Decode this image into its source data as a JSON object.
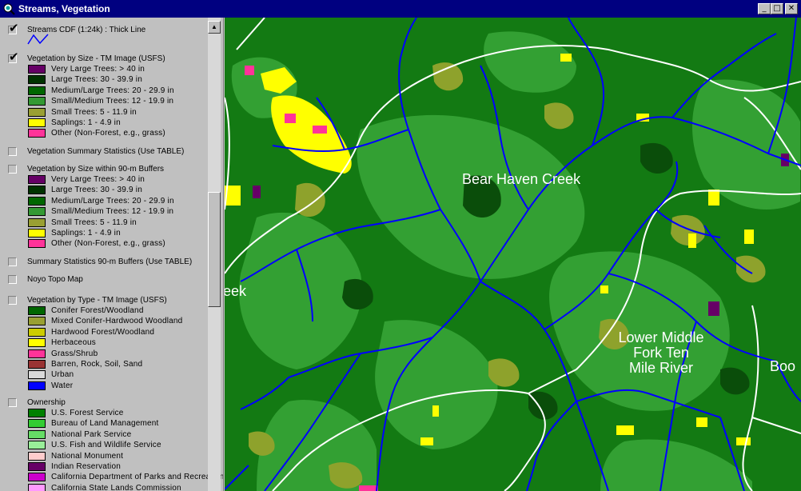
{
  "window": {
    "title": "Streams, Vegetation",
    "minimize_glyph": "_",
    "maximize_glyph": "□",
    "close_glyph": "✕"
  },
  "legend": {
    "streams": {
      "label": "Streams CDF (1:24k) : Thick Line",
      "checked": true
    },
    "veg_size": {
      "label": "Vegetation by Size - TM Image (USFS)",
      "checked": true,
      "classes": [
        {
          "label": "Very Large Trees: > 40  in",
          "color": "#660066"
        },
        {
          "label": "Large Trees: 30 - 39.9 in",
          "color": "#003300"
        },
        {
          "label": "Medium/Large Trees: 20 - 29.9 in",
          "color": "#006600"
        },
        {
          "label": "Small/Medium Trees: 12 - 19.9 in",
          "color": "#339933"
        },
        {
          "label": "Small Trees: 5 - 11.9 in",
          "color": "#99a033"
        },
        {
          "label": "Saplings: 1 - 4.9 in",
          "color": "#ffff00"
        },
        {
          "label": "Other (Non-Forest, e.g., grass)",
          "color": "#ff3399"
        }
      ]
    },
    "veg_summary": {
      "label": "Vegetation Summary Statistics (Use TABLE)",
      "checked": false
    },
    "veg_buffers": {
      "label": "Vegetation by Size within 90-m Buffers",
      "checked": false,
      "classes": [
        {
          "label": "Very Large Trees: > 40  in",
          "color": "#660066"
        },
        {
          "label": "Large Trees: 30 - 39.9 in",
          "color": "#003300"
        },
        {
          "label": "Medium/Large Trees: 20 - 29.9 in",
          "color": "#006600"
        },
        {
          "label": "Small/Medium Trees: 12 - 19.9 in",
          "color": "#339933"
        },
        {
          "label": "Small Trees: 5 - 11.9 in",
          "color": "#99a033"
        },
        {
          "label": "Saplings: 1 - 4.9 in",
          "color": "#ffff00"
        },
        {
          "label": "Other (Non-Forest, e.g., grass)",
          "color": "#ff3399"
        }
      ]
    },
    "summary_buffers": {
      "label": "Summary Statistics 90-m Buffers (Use TABLE)",
      "checked": false
    },
    "noyo_topo": {
      "label": "Noyo Topo Map",
      "checked": false
    },
    "veg_type": {
      "label": "Vegetation by Type - TM Image (USFS)",
      "checked": false,
      "classes": [
        {
          "label": "Conifer Forest/Woodland",
          "color": "#006600"
        },
        {
          "label": "Mixed Conifer-Hardwood Woodland",
          "color": "#99a033"
        },
        {
          "label": "Hardwood Forest/Woodland",
          "color": "#cccc00"
        },
        {
          "label": "Herbaceous",
          "color": "#ffff00"
        },
        {
          "label": "Grass/Shrub",
          "color": "#ff3399"
        },
        {
          "label": "Barren, Rock, Soil, Sand",
          "color": "#993333"
        },
        {
          "label": "Urban",
          "color": "#d9d9d9"
        },
        {
          "label": "Water",
          "color": "#0000ff"
        }
      ]
    },
    "ownership": {
      "label": "Ownership",
      "checked": false,
      "classes": [
        {
          "label": "U.S. Forest Service",
          "color": "#008000"
        },
        {
          "label": "Bureau of Land Management",
          "color": "#33cc33"
        },
        {
          "label": "National Park Service",
          "color": "#66dd66"
        },
        {
          "label": "U.S. Fish and Wildlife Service",
          "color": "#99ee99"
        },
        {
          "label": "National Monument",
          "color": "#ffcccc"
        },
        {
          "label": "Indian Reservation",
          "color": "#660066"
        },
        {
          "label": "California Department of Parks and Recreation",
          "color": "#cc00cc"
        },
        {
          "label": "California State Lands Commission",
          "color": "#ff99ff"
        }
      ]
    }
  },
  "map": {
    "labels": [
      {
        "text": "Bear Haven Creek"
      },
      {
        "text": "Lower Middle"
      },
      {
        "text": "Fork Ten"
      },
      {
        "text": "Mile River"
      },
      {
        "text": "eek"
      },
      {
        "text": "Boo"
      }
    ],
    "colors": {
      "forest_dark": "#006600",
      "forest_mid": "#339933",
      "forest_light": "#99a033",
      "streams": "#0000ff",
      "boundaries": "#ffffff",
      "saplings": "#ffff00",
      "other": "#ff3399"
    }
  }
}
